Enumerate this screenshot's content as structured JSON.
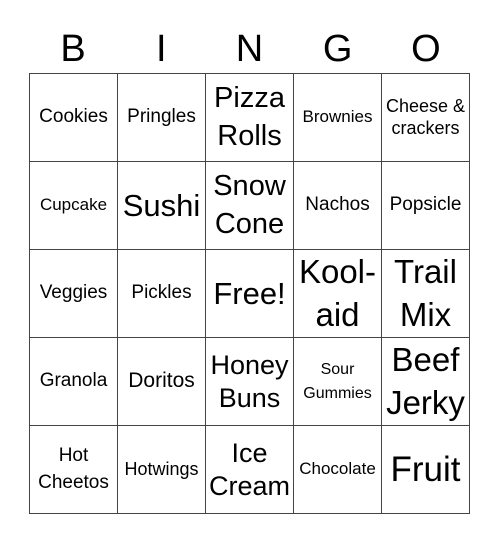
{
  "header": [
    "B",
    "I",
    "N",
    "G",
    "O"
  ],
  "grid": [
    [
      "Cookies",
      "Pringles",
      "Pizza Rolls",
      "Brownies",
      "Cheese & crackers"
    ],
    [
      "Cupcake",
      "Sushi",
      "Snow Cone",
      "Nachos",
      "Popsicle"
    ],
    [
      "Veggies",
      "Pickles",
      "Free!",
      "Kool-aid",
      "Trail Mix"
    ],
    [
      "Granola",
      "Doritos",
      "Honey Buns",
      "Sour Gummies",
      "Beef Jerky"
    ],
    [
      "Hot Cheetos",
      "Hotwings",
      "Ice Cream",
      "Chocolate",
      "Fruit"
    ]
  ]
}
